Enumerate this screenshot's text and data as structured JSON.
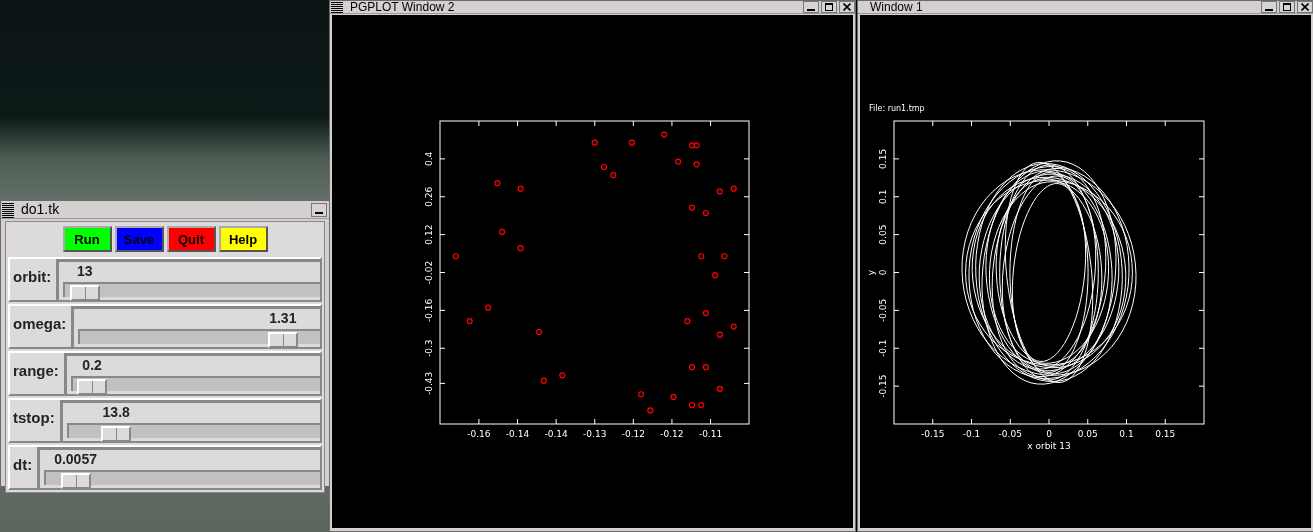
{
  "control_window": {
    "title": "do1.tk",
    "buttons": [
      {
        "label": "Run",
        "color": "#00ff00"
      },
      {
        "label": "Save",
        "color": "#0000ff"
      },
      {
        "label": "Quit",
        "color": "#ff0000"
      },
      {
        "label": "Help",
        "color": "#ffff00"
      }
    ],
    "sliders": [
      {
        "label": "orbit:",
        "value": "13",
        "level": 0.02
      },
      {
        "label": "omega:",
        "value": "1.31",
        "level": 0.91
      },
      {
        "label": "range:",
        "value": "0.2",
        "level": 0.02
      },
      {
        "label": "tstop:",
        "value": "13.8",
        "level": 0.15
      },
      {
        "label": "dt:",
        "value": "0.0057",
        "level": 0.06
      }
    ]
  },
  "plot_window_2": {
    "title": "PGPLOT Window 2",
    "chart_data": {
      "type": "scatter",
      "x": [
        -0.165,
        -0.162,
        -0.158,
        -0.156,
        -0.151,
        -0.155,
        -0.151,
        -0.147,
        -0.146,
        -0.142,
        -0.135,
        -0.133,
        -0.131,
        -0.127,
        -0.12,
        -0.117,
        -0.114,
        -0.113,
        -0.113,
        -0.114,
        -0.111,
        -0.108,
        -0.105,
        -0.112,
        -0.107,
        -0.109,
        -0.111,
        -0.115,
        -0.105,
        -0.108,
        -0.114,
        -0.111,
        -0.108,
        -0.125,
        -0.118,
        -0.123,
        -0.114,
        -0.112
      ],
      "series": [
        {
          "color": "#ff0000",
          "values": [
            0.04,
            -0.2,
            -0.15,
            0.31,
            0.29,
            0.13,
            0.07,
            -0.24,
            -0.42,
            -0.4,
            0.46,
            0.37,
            0.34,
            0.46,
            0.49,
            0.39,
            0.45,
            0.45,
            0.38,
            0.22,
            0.2,
            0.28,
            0.29,
            0.04,
            0.04,
            -0.03,
            -0.17,
            -0.2,
            -0.22,
            -0.25,
            -0.37,
            -0.37,
            -0.45,
            -0.47,
            -0.48,
            -0.53,
            -0.51,
            -0.51
          ]
        }
      ],
      "xlim": [
        -0.1684,
        -0.1017
      ],
      "ylim": [
        -0.58,
        0.54
      ],
      "xticks": [
        -0.16,
        -0.11
      ],
      "yticks": [
        0.4,
        0.26,
        0.12,
        -0.02,
        -0.16,
        -0.3,
        -0.43
      ]
    },
    "x_tick_labels_between": [
      "-0.14",
      "-0.14",
      "-0.13",
      "-0.12",
      "-0.12"
    ]
  },
  "plot_window_1": {
    "title": "Window 1",
    "file_label": "File: run1.tmp",
    "xlabel": "x orbit 13",
    "ylabel": "y",
    "xtick_labels": [
      "-0.15",
      "-0.1",
      "-0.05",
      "0",
      "0.05",
      "0.1",
      "0.15"
    ],
    "ytick_labels": [
      "0.15",
      "0.1",
      "0.05",
      "0",
      "-0.05",
      "-0.1",
      "-0.15"
    ]
  }
}
